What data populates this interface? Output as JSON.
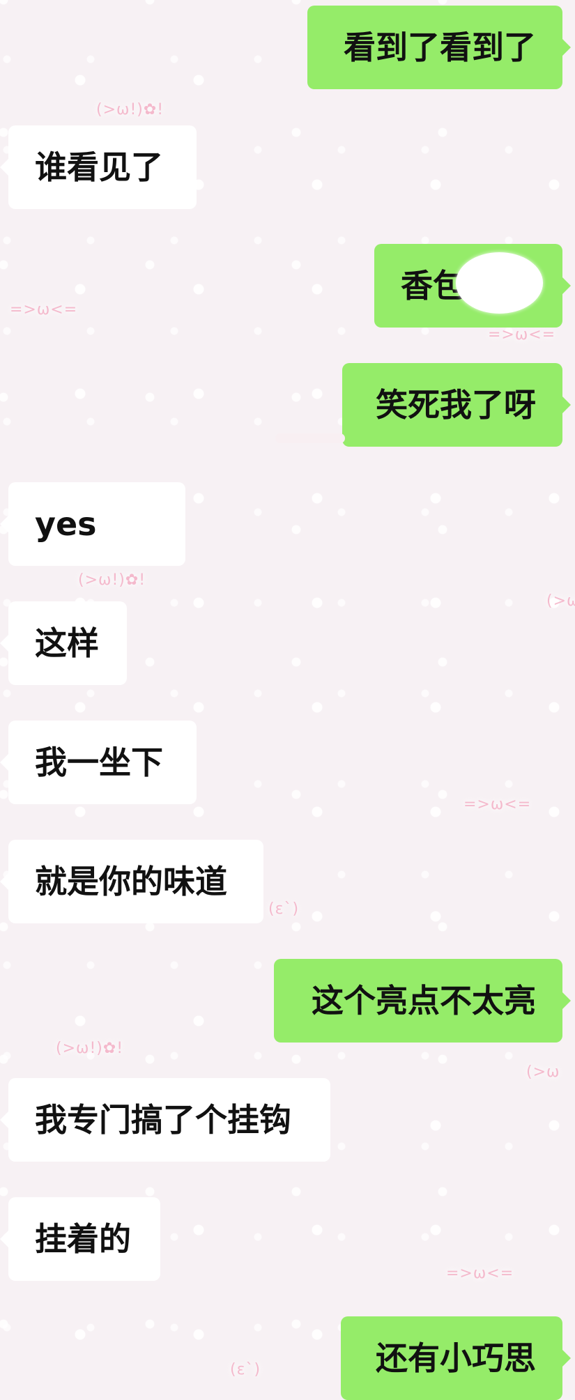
{
  "messages": [
    {
      "side": "out",
      "text": "看到了看到了"
    },
    {
      "side": "in",
      "text": "谁看见了"
    },
    {
      "side": "out",
      "text": "香包"
    },
    {
      "side": "out",
      "text": "笑死我了呀"
    },
    {
      "side": "in",
      "text": "yes"
    },
    {
      "side": "in",
      "text": "这样"
    },
    {
      "side": "in",
      "text": "我一坐下"
    },
    {
      "side": "in",
      "text": "就是你的味道"
    },
    {
      "side": "out",
      "text": "这个亮点不太亮"
    },
    {
      "side": "in",
      "text": "我专门搞了个挂钩"
    },
    {
      "side": "in",
      "text": "挂着的"
    },
    {
      "side": "out",
      "text": "还有小巧思"
    }
  ],
  "decorations": [
    "(>ω!)✿!",
    "=>ω<=",
    "=>ω<=",
    "(>ω!)✿!",
    "=>ω<=",
    "(ε`)",
    "(>ω!)✿!",
    "=>ω<=",
    "(ε`)",
    "(>ω",
    "(>ω"
  ],
  "colors": {
    "background": "#f7f1f4",
    "incoming_bubble": "#ffffff",
    "outgoing_bubble": "#95ec69",
    "text": "#111111",
    "decoration": "#f4a7bf"
  }
}
